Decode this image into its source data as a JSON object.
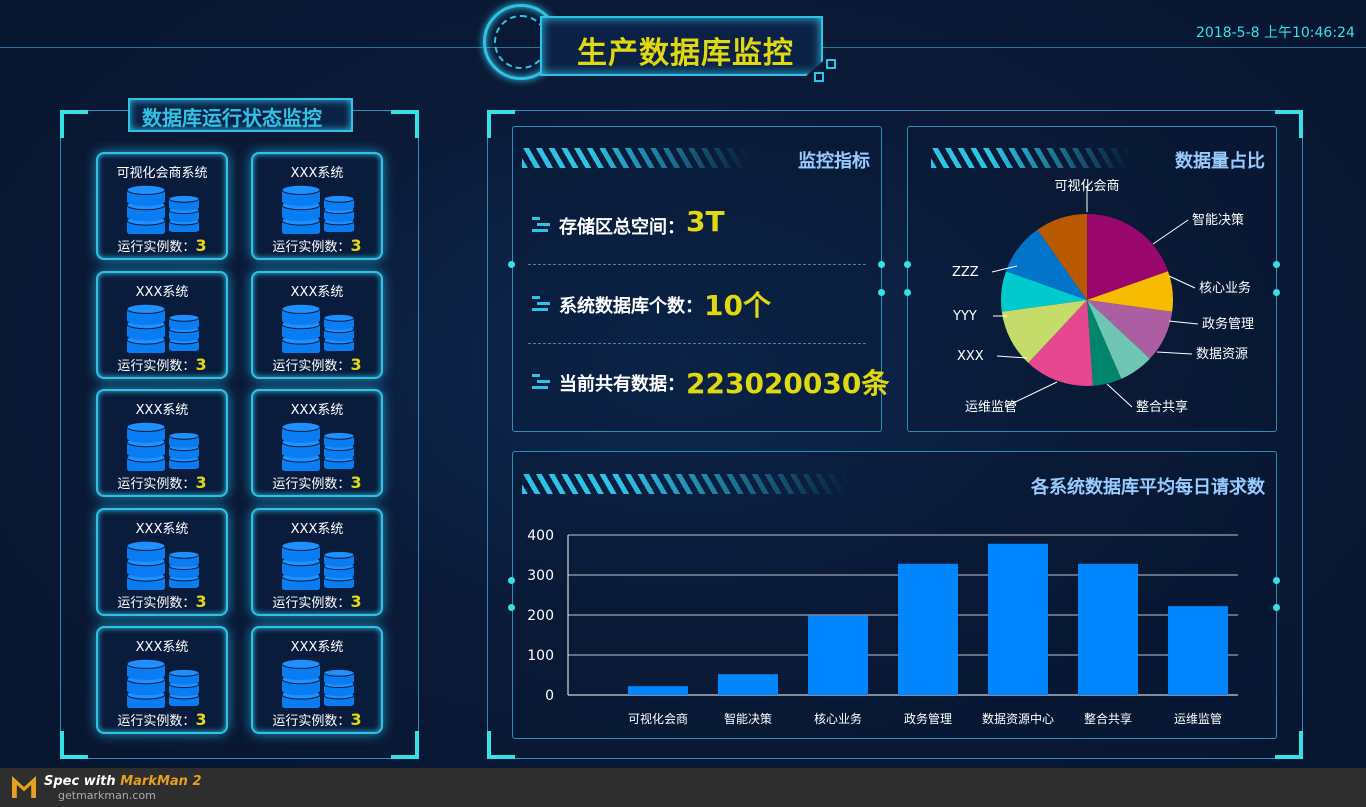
{
  "header": {
    "title": "生产数据库监控",
    "datetime": "2018-5-8  上午10:46:24"
  },
  "left": {
    "title": "数据库运行状态监控",
    "cards": [
      {
        "name": "可视化会商系统",
        "inst_label": "运行实例数：",
        "inst_value": "3"
      },
      {
        "name": "XXX系统",
        "inst_label": "运行实例数：",
        "inst_value": "3"
      },
      {
        "name": "XXX系统",
        "inst_label": "运行实例数：",
        "inst_value": "3"
      },
      {
        "name": "XXX系统",
        "inst_label": "运行实例数：",
        "inst_value": "3"
      },
      {
        "name": "XXX系统",
        "inst_label": "运行实例数：",
        "inst_value": "3"
      },
      {
        "name": "XXX系统",
        "inst_label": "运行实例数：",
        "inst_value": "3"
      },
      {
        "name": "XXX系统",
        "inst_label": "运行实例数：",
        "inst_value": "3"
      },
      {
        "name": "XXX系统",
        "inst_label": "运行实例数：",
        "inst_value": "3"
      },
      {
        "name": "XXX系统",
        "inst_label": "运行实例数：",
        "inst_value": "3"
      },
      {
        "name": "XXX系统",
        "inst_label": "运行实例数：",
        "inst_value": "3"
      }
    ]
  },
  "metrics": {
    "title": "监控指标",
    "items": [
      {
        "label": "存储区总空间：",
        "value": "3T"
      },
      {
        "label": "系统数据库个数：",
        "value": "10个"
      },
      {
        "label": "当前共有数据：",
        "value": "223020030条"
      }
    ]
  },
  "pie": {
    "title": "数据量占比"
  },
  "bar": {
    "title": "各系统数据库平均每日请求数"
  },
  "colors": {
    "accent": "#30c2e5",
    "cyan": "#34e2e6",
    "yellow": "#e0d911",
    "panel_title": "#98cbfe",
    "bar": "#0086ff"
  },
  "chart_data": [
    {
      "type": "pie",
      "title": "数据量占比",
      "categories": [
        "可视化会商",
        "智能决策",
        "核心业务",
        "政务管理",
        "数据资源",
        "整合共享",
        "运维监管",
        "XXX",
        "YYY",
        "ZZZ"
      ],
      "values": [
        18,
        7,
        9,
        6,
        5,
        12,
        10,
        7,
        9,
        9
      ],
      "colors": [
        "#9b086d",
        "#f7bc01",
        "#ac5ea2",
        "#6fc6b4",
        "#01866c",
        "#e64890",
        "#c5dc6b",
        "#01cacc",
        "#0275cb",
        "#b95900"
      ]
    },
    {
      "type": "bar",
      "title": "各系统数据库平均每日请求数",
      "categories": [
        "可视化会商",
        "智能决策",
        "核心业务",
        "政务管理",
        "数据资源中心",
        "整合共享",
        "运维监管"
      ],
      "values": [
        22,
        52,
        198,
        328,
        378,
        328,
        222
      ],
      "ylim": [
        0,
        400
      ],
      "yticks": [
        0,
        100,
        200,
        300,
        400
      ],
      "grid": true,
      "color": "#0086ff"
    }
  ]
}
